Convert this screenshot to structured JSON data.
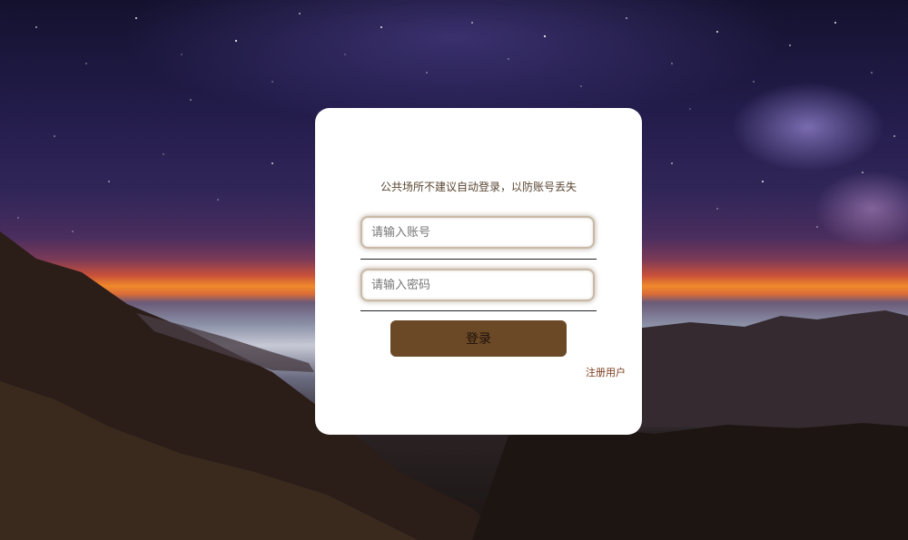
{
  "login": {
    "notice": "公共场所不建议自动登录，以防账号丢失",
    "username_placeholder": "请输入账号",
    "password_placeholder": "请输入密码",
    "submit_label": "登录",
    "register_label": "注册用户"
  },
  "colors": {
    "button_bg": "#6b4826",
    "register_link": "#7a3b1c",
    "card_bg": "#ffffff"
  }
}
